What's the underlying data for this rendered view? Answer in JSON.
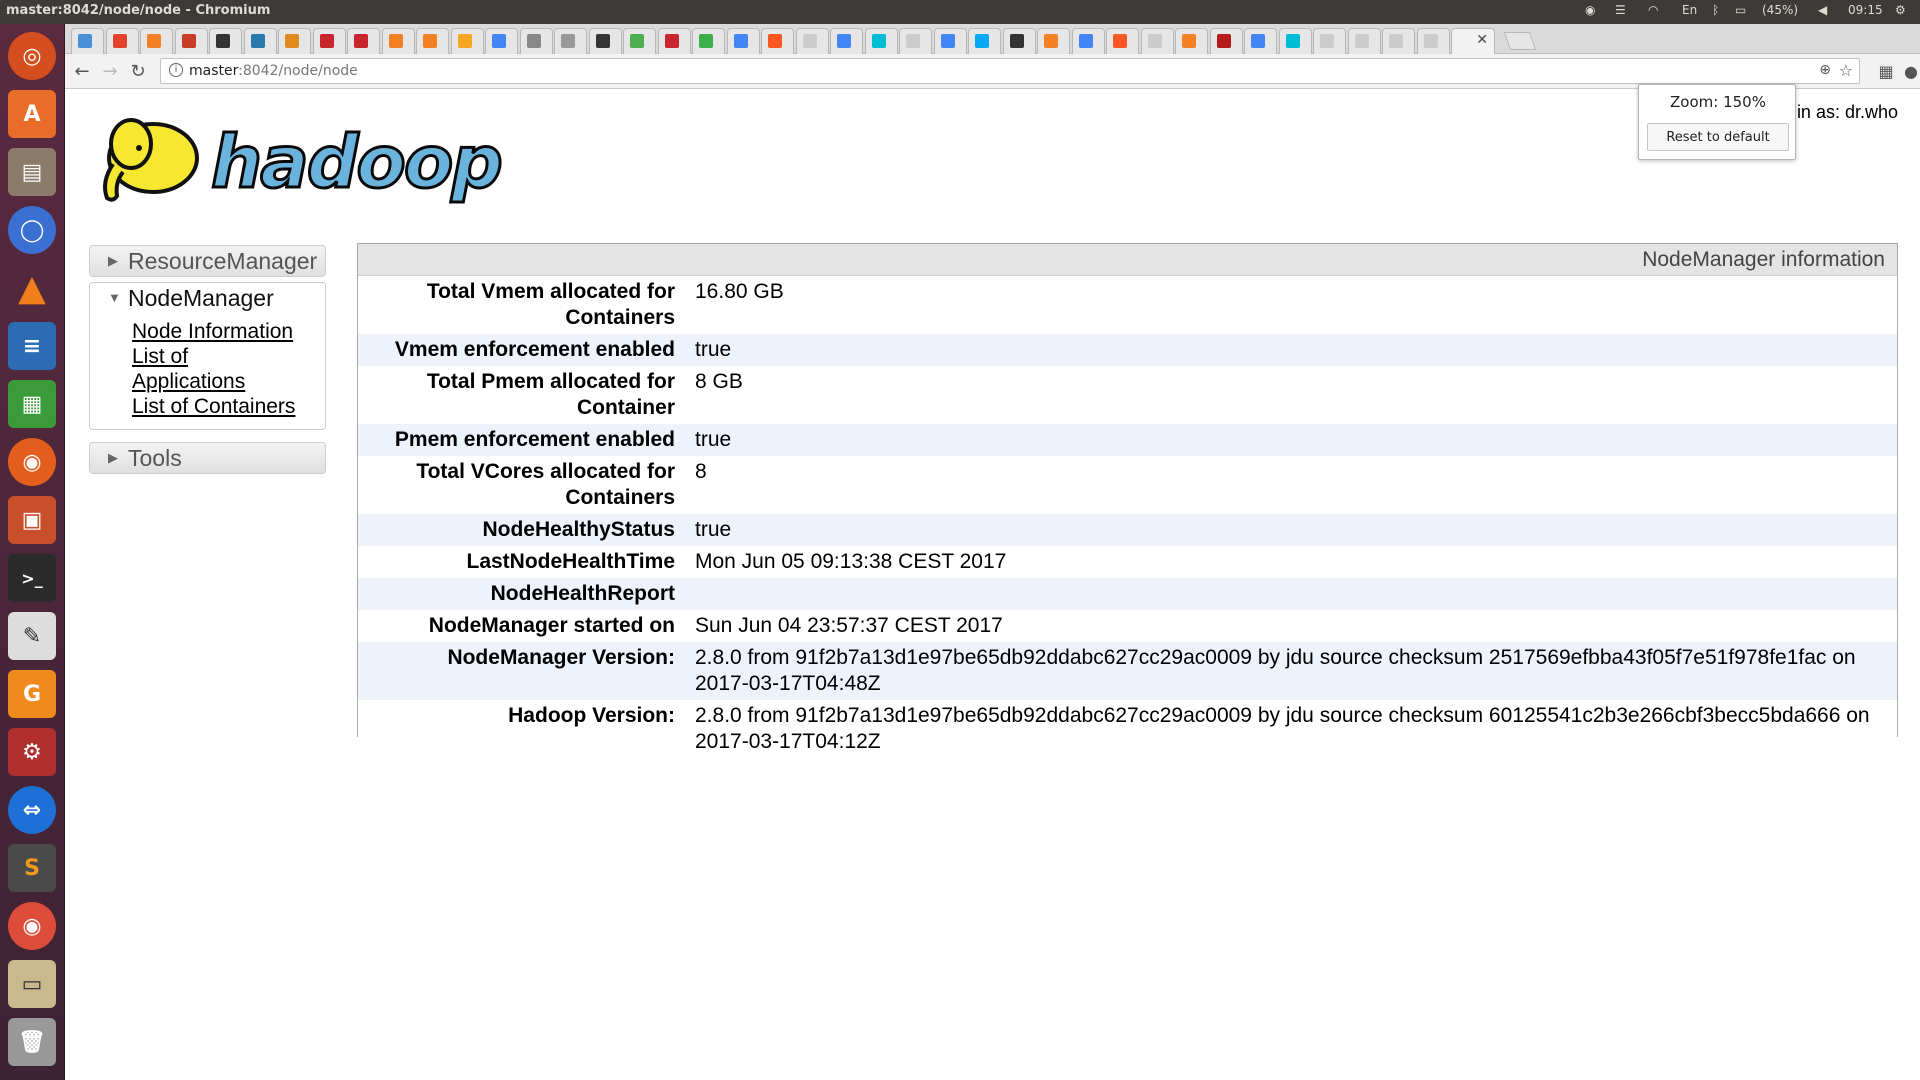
{
  "system": {
    "window_title": "master:8042/node/node - Chromium",
    "battery": "(45%)",
    "clock": "09:15",
    "keyboard": "En"
  },
  "browser": {
    "url_host": "master",
    "url_path": ":8042/node/node",
    "zoom_label": "Zoom: 150%",
    "zoom_reset": "Reset to default"
  },
  "page": {
    "logo_text": "hadoop",
    "logged_in": "in as: dr.who"
  },
  "sidebar": {
    "resourcemanager": "ResourceManager",
    "nodemanager": "NodeManager",
    "links": [
      "Node Information",
      "List of Applications",
      "List of Containers"
    ],
    "tools": "Tools"
  },
  "panel": {
    "title": "NodeManager information",
    "rows": [
      {
        "k": "Total Vmem allocated for Containers",
        "v": "16.80 GB"
      },
      {
        "k": "Vmem enforcement enabled",
        "v": "true"
      },
      {
        "k": "Total Pmem allocated for Container",
        "v": "8 GB"
      },
      {
        "k": "Pmem enforcement enabled",
        "v": "true"
      },
      {
        "k": "Total VCores allocated for Containers",
        "v": "8"
      },
      {
        "k": "NodeHealthyStatus",
        "v": "true"
      },
      {
        "k": "LastNodeHealthTime",
        "v": "Mon Jun 05 09:13:38 CEST 2017"
      },
      {
        "k": "NodeHealthReport",
        "v": ""
      },
      {
        "k": "NodeManager started on",
        "v": "Sun Jun 04 23:57:37 CEST 2017"
      },
      {
        "k": "NodeManager Version:",
        "v": "2.8.0 from 91f2b7a13d1e97be65db92ddabc627cc29ac0009 by jdu source checksum 2517569efbba43f05f7e51f978fe1fac on 2017-03-17T04:48Z"
      },
      {
        "k": "Hadoop Version:",
        "v": "2.8.0 from 91f2b7a13d1e97be65db92ddabc627cc29ac0009 by jdu source checksum 60125541c2b3e266cbf3becc5bda666 on 2017-03-17T04:12Z"
      }
    ]
  },
  "launcher_icons": [
    "ubuntu-dash-icon",
    "software-center-icon",
    "files-icon",
    "chromium-icon",
    "vlc-icon",
    "writer-icon",
    "calc-icon",
    "firefox-icon",
    "impress-icon",
    "terminal-icon",
    "text-editor-icon",
    "pdf-icon",
    "settings-icon",
    "teamviewer-icon",
    "sublime-icon",
    "chrome-icon",
    "scanner-icon",
    "trash-icon"
  ]
}
